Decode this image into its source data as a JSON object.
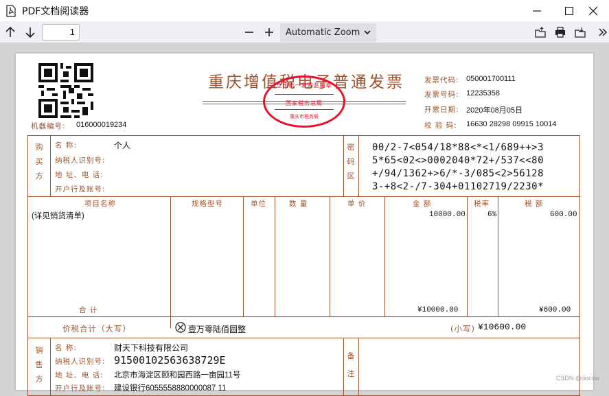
{
  "window": {
    "title": "PDF文档阅读器"
  },
  "toolbar": {
    "page_number": "1",
    "zoom": "Automatic Zoom"
  },
  "invoice": {
    "title": "重庆增值税电子普通发票",
    "machine_label": "机器编号:",
    "machine_no": "016000019234",
    "code_label": "发票代码:",
    "code": "050001700111",
    "number_label": "发票号码:",
    "number": "12235358",
    "date_label": "开票日期:",
    "date": "2020年08月05日",
    "check_label": "校 验 码:",
    "check": "16630 28298 09915 10014",
    "stamp": {
      "top": "全国统一发票监制章",
      "middle": "国家税务总局",
      "bottom": "重庆市税务局"
    },
    "buyer": {
      "section": [
        "购",
        "买",
        "方"
      ],
      "name_label": "名      称:",
      "name": "个人",
      "taxid_label": "纳税人识别号:",
      "addr_label": "地 址、电 话:",
      "bank_label": "开户行及账号:"
    },
    "cipher": {
      "section": [
        "密",
        "码",
        "区"
      ],
      "lines": [
        "00/2-7<054/18*88<*<1/689++>3",
        "5*65<02<>0002040*72+/537<<80",
        "+/94/1362+>6/*-3/085<2>56128",
        "3-+8<2-/7-304+01102719/2230*"
      ]
    },
    "columns": [
      "项目名称",
      "规格型号",
      "单位",
      "数 量",
      "单 价",
      "金 额",
      "税率",
      "税 额"
    ],
    "item": {
      "name": "(详见销货清单)",
      "amount": "10000.00",
      "rate": "6%",
      "tax": "600.00"
    },
    "total_label": "合      计",
    "total_amount": "¥10000.00",
    "total_tax": "¥600.00",
    "sum_label": "价税合计（大写）",
    "sum_words": "壹万零陆佰圆整",
    "sum_small_label": "(小写)",
    "sum_small": "¥10600.00",
    "seller": {
      "section": [
        "销",
        "售",
        "方"
      ],
      "name_label": "名      称:",
      "name": "财天下科技有限公司",
      "taxid_label": "纳税人识别号:",
      "taxid": "91500102563638729E",
      "addr_label": "地 址、电 话:",
      "addr": "北京市海淀区颐和园西路一亩园11号",
      "bank_label": "开户行及账号:",
      "bank": "建设银行6055558880000087 11"
    },
    "remark": [
      "备",
      "注"
    ]
  },
  "watermark": "CSDN @docow",
  "colors": {
    "accent": "#a0522d",
    "stamp": "#e8102b"
  }
}
